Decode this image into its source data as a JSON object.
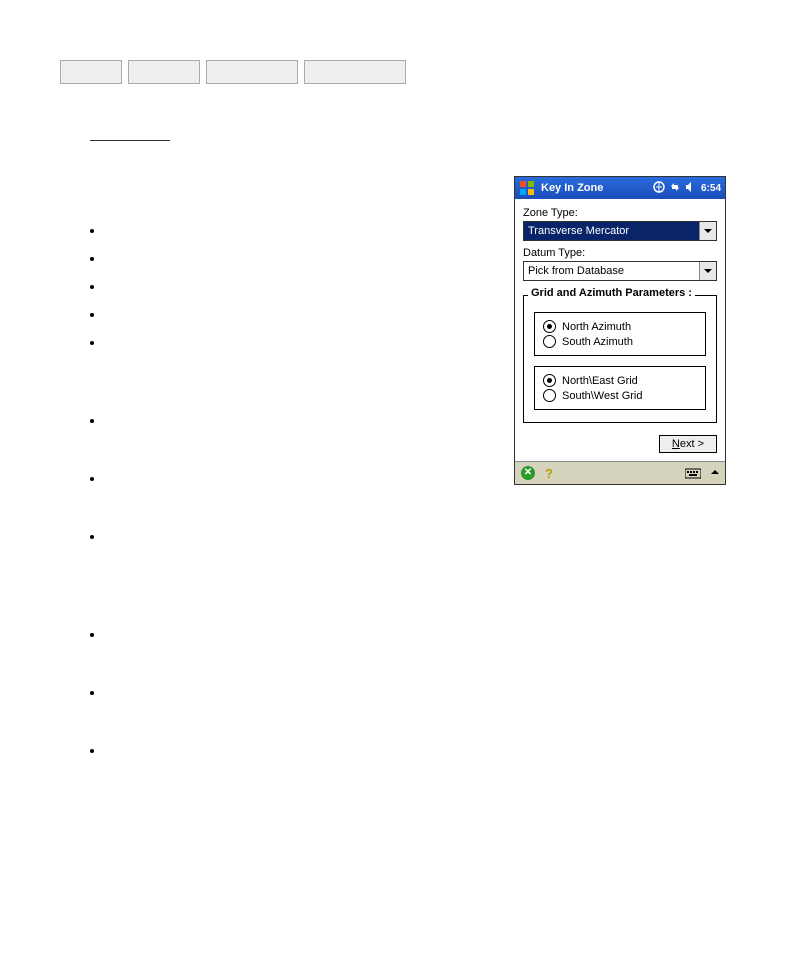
{
  "dialog": {
    "title": "Key In Zone",
    "time": "6:54",
    "zone_type_label": "Zone Type:",
    "zone_type_value": "Transverse Mercator",
    "datum_type_label": "Datum Type:",
    "datum_type_value": "Pick from Database",
    "group_title": "Grid and Azimuth Parameters :",
    "azimuth": {
      "north": "North Azimuth",
      "south": "South Azimuth"
    },
    "grid": {
      "north_east": "North\\East Grid",
      "south_west": "South\\West Grid"
    },
    "next_btn_prefix": "N",
    "next_btn_rest": "ext >"
  }
}
